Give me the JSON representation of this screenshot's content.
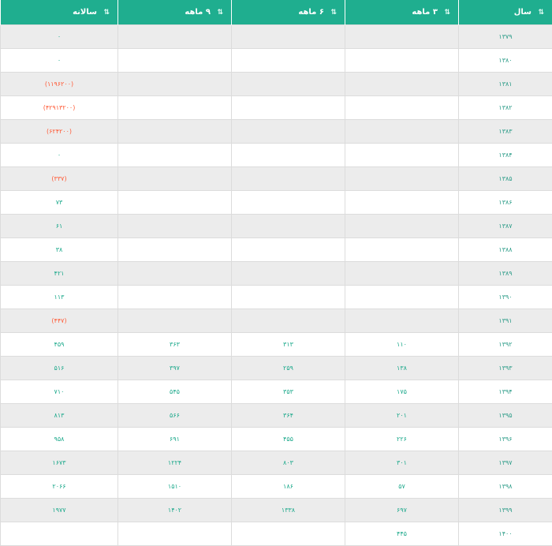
{
  "headers": {
    "year": "سال",
    "three_month": "۳ ماهه",
    "six_month": "۶ ماهه",
    "nine_month": "۹ ماهه",
    "annual": "سالانه"
  },
  "icons": {
    "sort": "sort-arrows-icon"
  },
  "colors": {
    "header_bg": "#1fae8f",
    "value": "#1aa88a",
    "negative": "#ff5a36"
  },
  "rows": [
    {
      "year": "۱۳۷۹",
      "m3": "",
      "m6": "",
      "m9": "",
      "annual": "۰"
    },
    {
      "year": "۱۳۸۰",
      "m3": "",
      "m6": "",
      "m9": "",
      "annual": "۰"
    },
    {
      "year": "۱۳۸۱",
      "m3": "",
      "m6": "",
      "m9": "",
      "annual": "(۱۱۹۶۲۰۰)"
    },
    {
      "year": "۱۳۸۲",
      "m3": "",
      "m6": "",
      "m9": "",
      "annual": "(۴۲۹۱۳۲۰۰)"
    },
    {
      "year": "۱۳۸۳",
      "m3": "",
      "m6": "",
      "m9": "",
      "annual": "(۶۲۴۲۰۰)"
    },
    {
      "year": "۱۳۸۴",
      "m3": "",
      "m6": "",
      "m9": "",
      "annual": "۰"
    },
    {
      "year": "۱۳۸۵",
      "m3": "",
      "m6": "",
      "m9": "",
      "annual": "(۳۳۷)"
    },
    {
      "year": "۱۳۸۶",
      "m3": "",
      "m6": "",
      "m9": "",
      "annual": "۷۳"
    },
    {
      "year": "۱۳۸۷",
      "m3": "",
      "m6": "",
      "m9": "",
      "annual": "۶۱"
    },
    {
      "year": "۱۳۸۸",
      "m3": "",
      "m6": "",
      "m9": "",
      "annual": "۳۸"
    },
    {
      "year": "۱۳۸۹",
      "m3": "",
      "m6": "",
      "m9": "",
      "annual": "۴۲۱"
    },
    {
      "year": "۱۳۹۰",
      "m3": "",
      "m6": "",
      "m9": "",
      "annual": "۱۱۳"
    },
    {
      "year": "۱۳۹۱",
      "m3": "",
      "m6": "",
      "m9": "",
      "annual": "(۴۴۷)"
    },
    {
      "year": "۱۳۹۲",
      "m3": "۱۱۰",
      "m6": "۳۱۳",
      "m9": "۳۶۳",
      "annual": "۴۵۹"
    },
    {
      "year": "۱۳۹۳",
      "m3": "۱۳۸",
      "m6": "۲۵۹",
      "m9": "۳۹۷",
      "annual": "۵۱۶"
    },
    {
      "year": "۱۳۹۴",
      "m3": "۱۷۵",
      "m6": "۳۵۳",
      "m9": "۵۴۵",
      "annual": "۷۱۰"
    },
    {
      "year": "۱۳۹۵",
      "m3": "۲۰۱",
      "m6": "۳۶۴",
      "m9": "۵۶۶",
      "annual": "۸۱۳"
    },
    {
      "year": "۱۳۹۶",
      "m3": "۲۲۶",
      "m6": "۴۵۵",
      "m9": "۶۹۱",
      "annual": "۹۵۸"
    },
    {
      "year": "۱۳۹۷",
      "m3": "۳۰۱",
      "m6": "۸۰۳",
      "m9": "۱۲۲۴",
      "annual": "۱۶۷۳"
    },
    {
      "year": "۱۳۹۸",
      "m3": "۵۷",
      "m6": "۱۸۶",
      "m9": "۱۵۱۰",
      "annual": "۲۰۶۶"
    },
    {
      "year": "۱۳۹۹",
      "m3": "۶۹۷",
      "m6": "۱۳۳۸",
      "m9": "۱۴۰۲",
      "annual": "۱۹۷۷"
    },
    {
      "year": "۱۴۰۰",
      "m3": "۴۴۵",
      "m6": "",
      "m9": "",
      "annual": ""
    }
  ]
}
